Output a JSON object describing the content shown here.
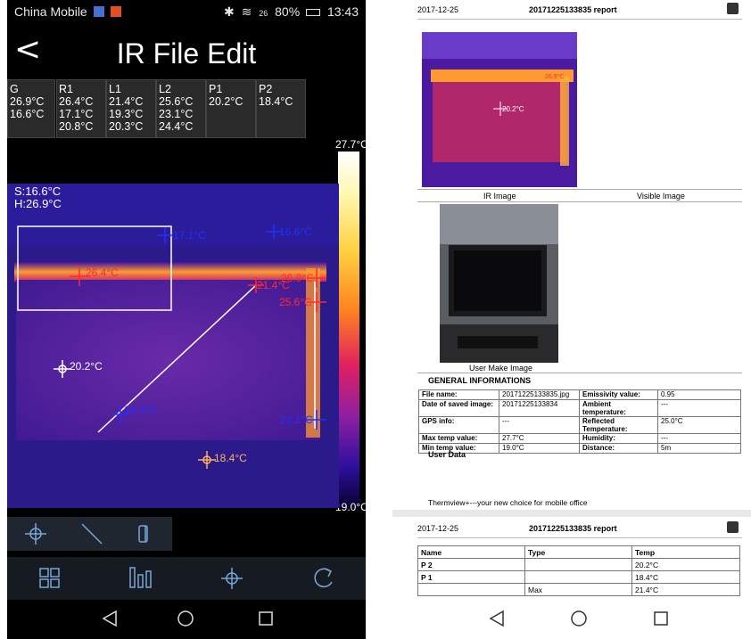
{
  "left_phone": {
    "status": {
      "carrier": "China Mobile",
      "signal": "26",
      "battery": "80%",
      "time": "13:43"
    },
    "title": "IR File Edit",
    "chips": [
      {
        "name": "G",
        "l1": "26.9°C",
        "l2": "16.6°C",
        "l3": ""
      },
      {
        "name": "R1",
        "l1": "26.4°C",
        "l2": "17.1°C",
        "l3": "20.8°C"
      },
      {
        "name": "L1",
        "l1": "21.4°C",
        "l2": "19.3°C",
        "l3": "20.3°C"
      },
      {
        "name": "L2",
        "l1": "25.6°C",
        "l2": "23.1°C",
        "l3": "24.4°C"
      },
      {
        "name": "P1",
        "l1": "",
        "l2": "20.2°C",
        "l3": ""
      },
      {
        "name": "P2",
        "l1": "",
        "l2": "18.4°C",
        "l3": ""
      }
    ],
    "scene_min_label": "S:16.6°C",
    "scene_max_label": "H:26.9°C",
    "colorbar_max": "27.7°C",
    "colorbar_min": "19.0°C",
    "markers": {
      "r1_cold": "17.1°C",
      "r1_hot": "26.4°C",
      "l2_cold": "16.6°C",
      "l1_hot": "21.4°C",
      "g_hot": "26.9°C",
      "l2_hot": "25.6°C",
      "l1_cold": "19.3°C",
      "l2_low": "23.1°C",
      "p1": "20.2°C",
      "p2": "18.4°C"
    },
    "tools": [
      "point-tool-icon",
      "line-tool-icon",
      "area-tool-icon"
    ],
    "bottom_icons": [
      "grid-icon",
      "bars-icon",
      "crosshair-icon",
      "refresh-icon"
    ],
    "nav": [
      "back-nav-icon",
      "home-nav-icon",
      "recents-nav-icon"
    ],
    "colors": {
      "accent_red": "#ff2a2a",
      "marker_blue": "#2030ff",
      "marker_orange": "#ffb060"
    }
  },
  "right_doc": {
    "page1": {
      "date": "2017-12-25",
      "report_title": "20171225133835 report",
      "ir_point_label": "20.2°C",
      "ir_hot_label": "26.9°C",
      "ir_caption": "IR Image",
      "visible_caption": "Visible Image",
      "photo_caption": "User Make Image",
      "general_title": "GENERAL INFORMATIONS",
      "general_rows": [
        [
          "File name:",
          "20171225133835.jpg",
          "Emissivity value:",
          "0.95"
        ],
        [
          "Date of saved image:",
          "20171225133834",
          "Ambient temperature:",
          "---"
        ],
        [
          "GPS info:",
          "---",
          "Reflected Temperature:",
          "25.0°C"
        ],
        [
          "Max temp value:",
          "27.7°C",
          "Humidity:",
          "---"
        ],
        [
          "Min temp value:",
          "19.0°C",
          "Distance:",
          "5m"
        ]
      ],
      "user_data": "User Data",
      "footer": "Thermview+---your new choice for mobile office"
    },
    "page2": {
      "date": "2017-12-25",
      "report_title": "20171225133835 report",
      "headers": [
        "Name",
        "Type",
        "Temp"
      ],
      "rows": [
        [
          "P 2",
          "",
          "20.2°C"
        ],
        [
          "P 1",
          "",
          "18.4°C"
        ],
        [
          "",
          "Max",
          "21.4°C"
        ]
      ]
    }
  }
}
